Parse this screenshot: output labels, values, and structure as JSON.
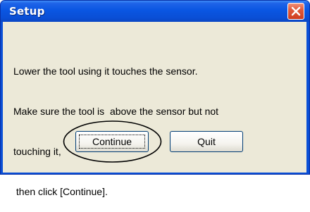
{
  "window": {
    "title": "Setup"
  },
  "titlebar": {
    "close_icon": "close-x-icon"
  },
  "message": {
    "lines": [
      "Lower the tool using it touches the sensor.",
      "Make sure the tool is  above the sensor but not",
      "touching it,",
      " then click [Continue]."
    ]
  },
  "buttons": {
    "continue_label": "Continue",
    "quit_label": "Quit"
  },
  "colors": {
    "titlebar": "#0a4fd6",
    "client_bg": "#ece9d8",
    "close_button": "#e05a3c",
    "button_border": "#003c74"
  }
}
